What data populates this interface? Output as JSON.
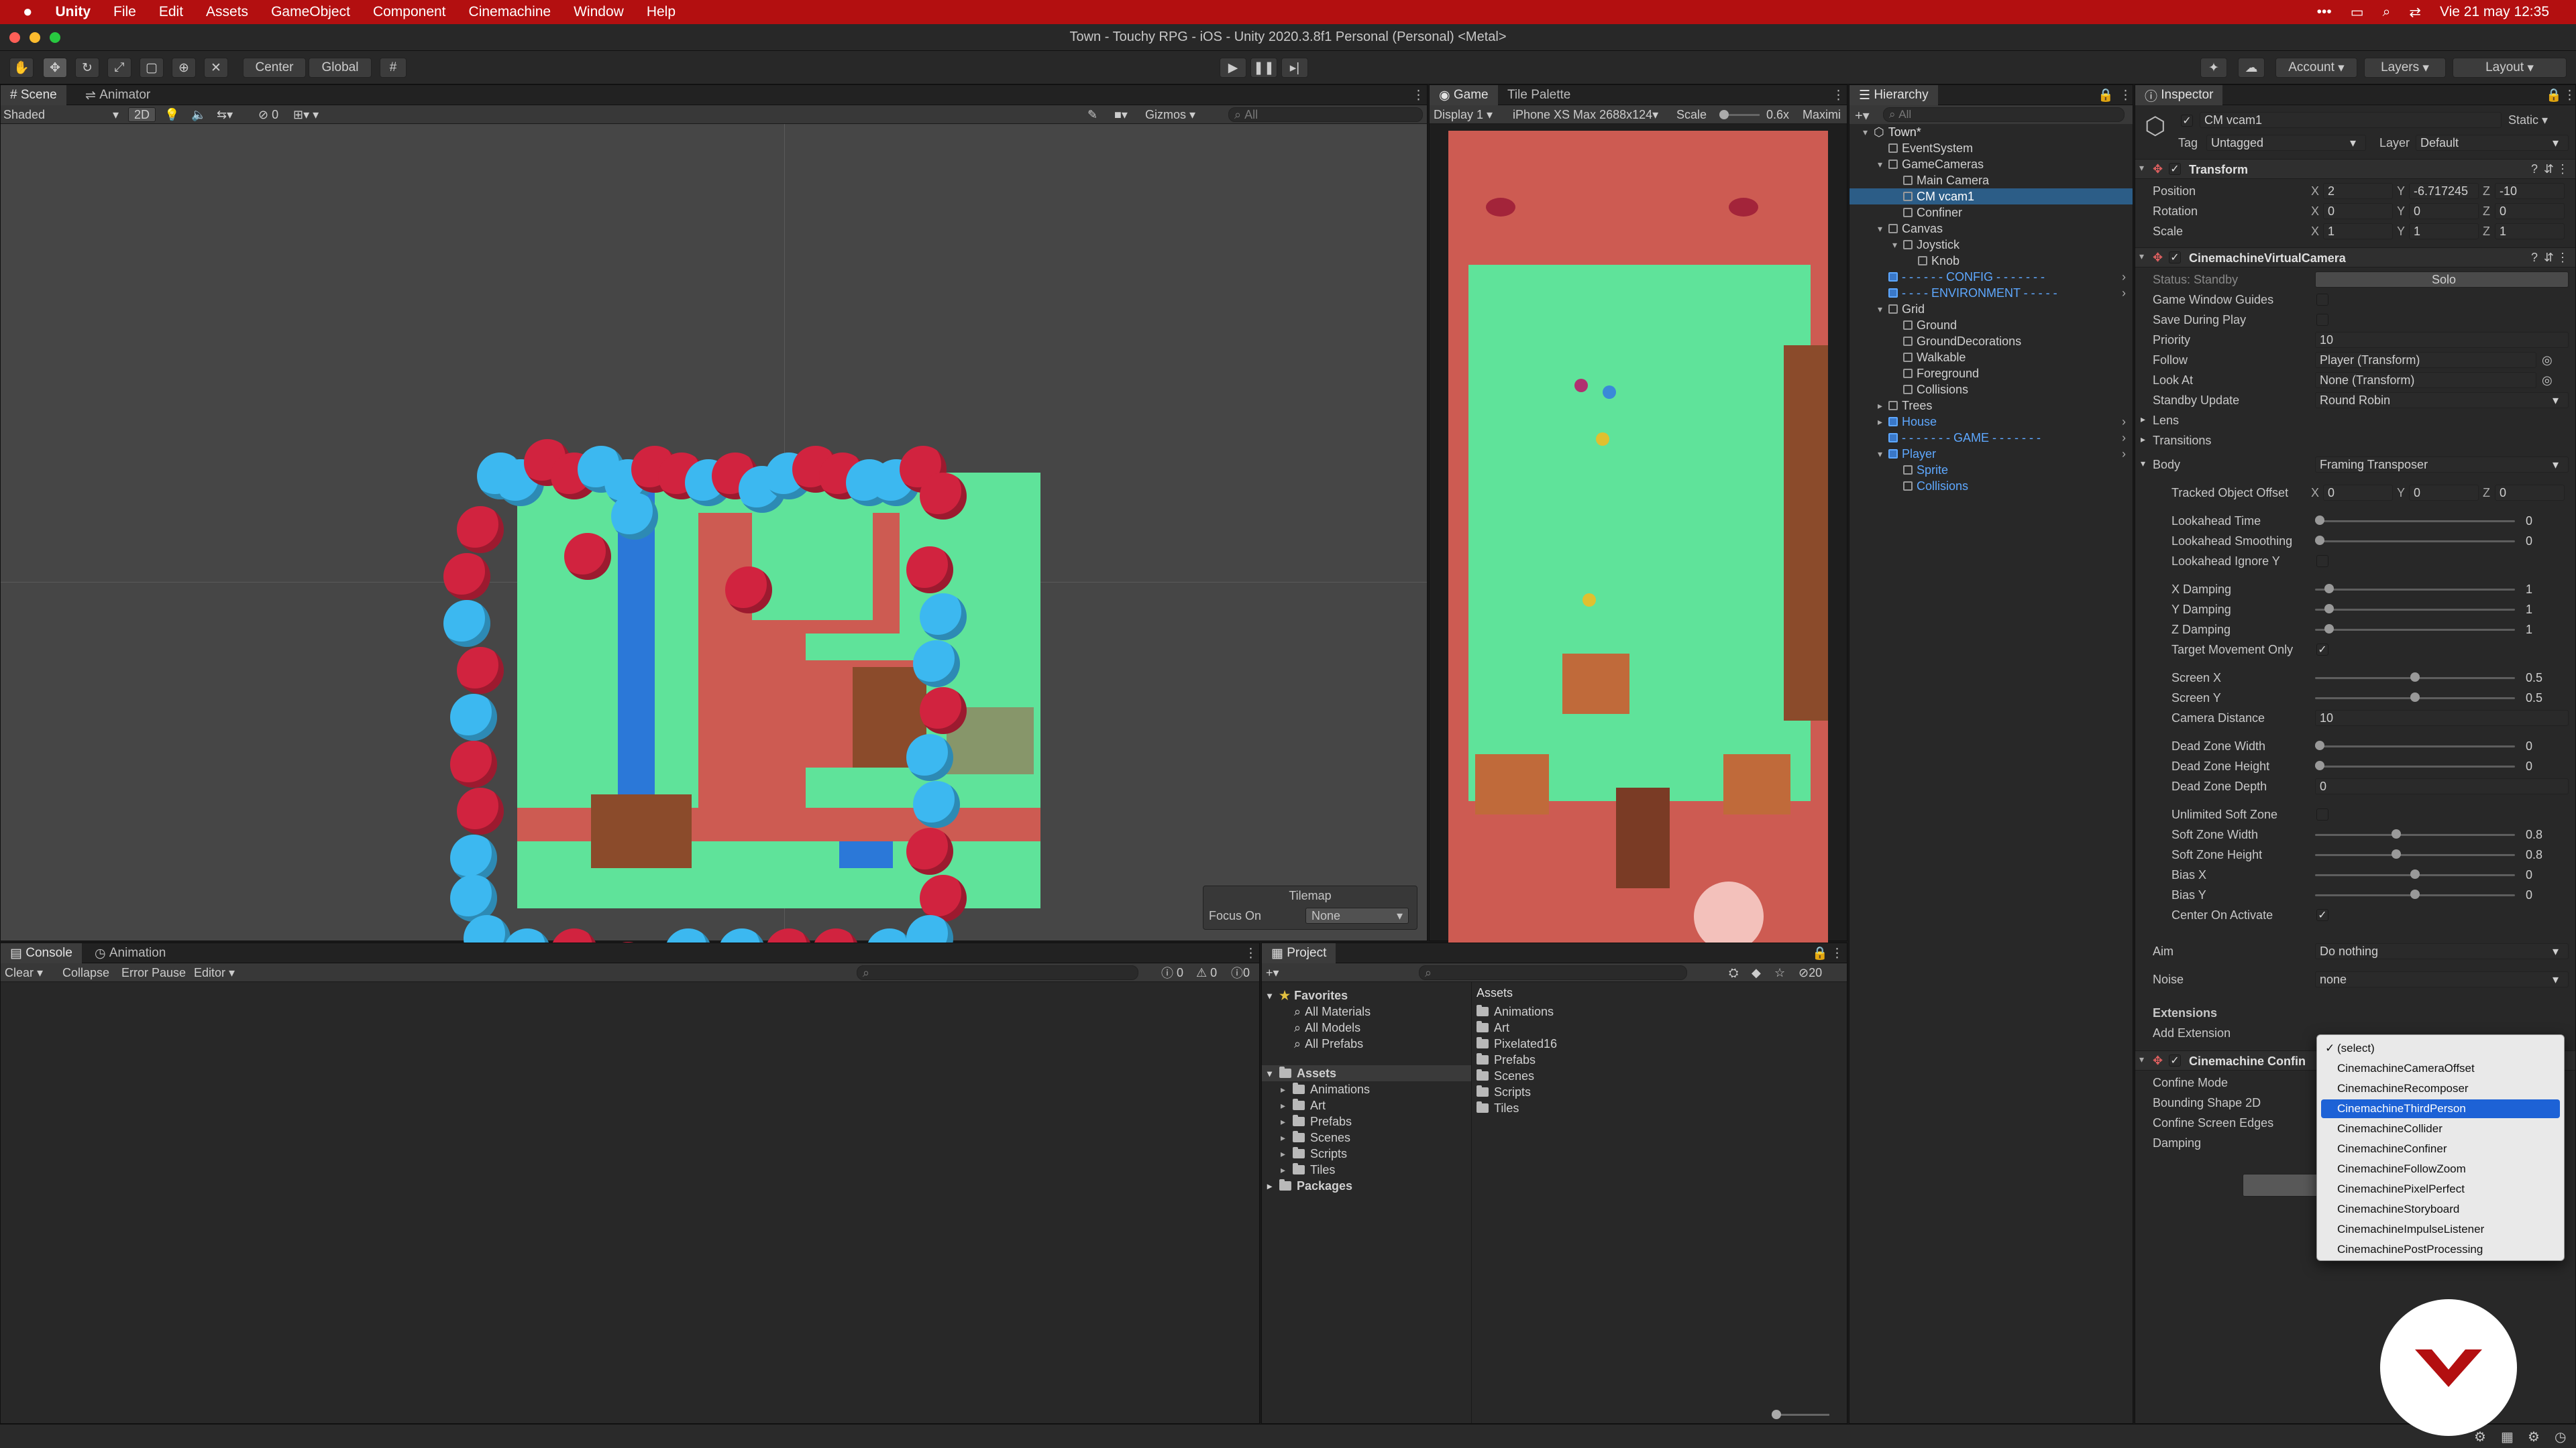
{
  "mac_menu": {
    "app": "Unity",
    "items": [
      "File",
      "Edit",
      "Assets",
      "GameObject",
      "Component",
      "Cinemachine",
      "Window",
      "Help"
    ],
    "clock": "Vie 21 may  12:35"
  },
  "window": {
    "title": "Town - Touchy RPG - iOS - Unity 2020.3.8f1 Personal (Personal) <Metal>"
  },
  "toolbar": {
    "pivot": "Center",
    "space": "Global",
    "account": "Account",
    "layers": "Layers",
    "layout": "Layout"
  },
  "scene": {
    "tabs": [
      "Scene",
      "Animator"
    ],
    "shading": "Shaded",
    "mode2d": "2D",
    "gizmos": "Gizmos",
    "search_placeholder": "All",
    "hidden_count": "0",
    "tilemap_overlay": {
      "title": "Tilemap",
      "focus_label": "Focus On",
      "focus_value": "None"
    }
  },
  "game": {
    "tabs": [
      "Game",
      "Tile Palette"
    ],
    "display": "Display 1",
    "resolution": "iPhone XS Max 2688x124",
    "scale_label": "Scale",
    "scale_value": "0.6x",
    "maximize": "Maximi"
  },
  "hierarchy": {
    "tab": "Hierarchy",
    "search_placeholder": "All",
    "items": [
      {
        "label": "Town*",
        "depth": 0,
        "arrow": "▾",
        "color": "#e0e0e0",
        "icon": "unity-scene-icon"
      },
      {
        "label": "EventSystem",
        "depth": 1,
        "arrow": "",
        "color": "#d0d0d0"
      },
      {
        "label": "GameCameras",
        "depth": 1,
        "arrow": "▾",
        "color": "#d0d0d0"
      },
      {
        "label": "Main Camera",
        "depth": 2,
        "arrow": "",
        "color": "#d0d0d0"
      },
      {
        "label": "CM vcam1",
        "depth": 2,
        "arrow": "",
        "color": "#ffffff",
        "selected": true
      },
      {
        "label": "Confiner",
        "depth": 2,
        "arrow": "",
        "color": "#d0d0d0"
      },
      {
        "label": "Canvas",
        "depth": 1,
        "arrow": "▾",
        "color": "#d0d0d0"
      },
      {
        "label": "Joystick",
        "depth": 2,
        "arrow": "▾",
        "color": "#d0d0d0"
      },
      {
        "label": "Knob",
        "depth": 3,
        "arrow": "",
        "color": "#d0d0d0"
      },
      {
        "label": "- - - - - - CONFIG - - - - - - -",
        "depth": 1,
        "arrow": "",
        "color": "#5ea8ff",
        "prefab": true
      },
      {
        "label": "- - - - ENVIRONMENT - - - - -",
        "depth": 1,
        "arrow": "",
        "color": "#5ea8ff",
        "prefab": true
      },
      {
        "label": "Grid",
        "depth": 1,
        "arrow": "▾",
        "color": "#d0d0d0"
      },
      {
        "label": "Ground",
        "depth": 2,
        "arrow": "",
        "color": "#d0d0d0"
      },
      {
        "label": "GroundDecorations",
        "depth": 2,
        "arrow": "",
        "color": "#d0d0d0"
      },
      {
        "label": "Walkable",
        "depth": 2,
        "arrow": "",
        "color": "#d0d0d0"
      },
      {
        "label": "Foreground",
        "depth": 2,
        "arrow": "",
        "color": "#d0d0d0"
      },
      {
        "label": "Collisions",
        "depth": 2,
        "arrow": "",
        "color": "#d0d0d0"
      },
      {
        "label": "Trees",
        "depth": 1,
        "arrow": "▸",
        "color": "#d0d0d0"
      },
      {
        "label": "House",
        "depth": 1,
        "arrow": "▸",
        "color": "#5ea8ff",
        "prefab": true
      },
      {
        "label": "- - - - - - - GAME - - - - - - -",
        "depth": 1,
        "arrow": "",
        "color": "#5ea8ff",
        "prefab": true
      },
      {
        "label": "Player",
        "depth": 1,
        "arrow": "▾",
        "color": "#5ea8ff",
        "prefab": true
      },
      {
        "label": "Sprite",
        "depth": 2,
        "arrow": "",
        "color": "#5ea8ff"
      },
      {
        "label": "Collisions",
        "depth": 2,
        "arrow": "",
        "color": "#5ea8ff"
      }
    ]
  },
  "inspector": {
    "tab": "Inspector",
    "object_name": "CM vcam1",
    "static_label": "Static",
    "tag_label": "Tag",
    "tag_value": "Untagged",
    "layer_label": "Layer",
    "layer_value": "Default",
    "transform": {
      "title": "Transform",
      "rows": [
        {
          "label": "Position",
          "x": "2",
          "y": "-6.717245",
          "z": "-10"
        },
        {
          "label": "Rotation",
          "x": "0",
          "y": "0",
          "z": "0"
        },
        {
          "label": "Scale",
          "x": "1",
          "y": "1",
          "z": "1"
        }
      ]
    },
    "vcam": {
      "title": "CinemachineVirtualCamera",
      "status_label": "Status: Standby",
      "solo": "Solo",
      "game_window_guides": "Game Window Guides",
      "save_during_play": "Save During Play",
      "priority_label": "Priority",
      "priority": "10",
      "follow_label": "Follow",
      "follow": "Player (Transform)",
      "lookat_label": "Look At",
      "lookat": "None (Transform)",
      "standby_label": "Standby Update",
      "standby": "Round Robin",
      "lens": "Lens",
      "transitions": "Transitions",
      "body_label": "Body",
      "body": "Framing Transposer",
      "tracked_offset_label": "Tracked Object Offset",
      "tracked_offset": {
        "x": "0",
        "y": "0",
        "z": "0"
      },
      "sliders": [
        {
          "label": "Lookahead Time",
          "value": "0",
          "fraction": 0
        },
        {
          "label": "Lookahead Smoothing",
          "value": "0",
          "fraction": 0
        }
      ],
      "lookahead_ignore_y": "Lookahead Ignore Y",
      "damping": [
        {
          "label": "X Damping",
          "value": "1",
          "fraction": 0.05
        },
        {
          "label": "Y Damping",
          "value": "1",
          "fraction": 0.05
        },
        {
          "label": "Z Damping",
          "value": "1",
          "fraction": 0.05
        }
      ],
      "target_movement_only": "Target Movement Only",
      "screen": [
        {
          "label": "Screen X",
          "value": "0.5",
          "fraction": 0.5
        },
        {
          "label": "Screen Y",
          "value": "0.5",
          "fraction": 0.5
        }
      ],
      "camera_distance_label": "Camera Distance",
      "camera_distance": "10",
      "dead_zone": [
        {
          "label": "Dead Zone Width",
          "value": "0",
          "fraction": 0
        },
        {
          "label": "Dead Zone Height",
          "value": "0",
          "fraction": 0
        }
      ],
      "dead_zone_depth_label": "Dead Zone Depth",
      "dead_zone_depth": "0",
      "unlimited_soft_zone": "Unlimited Soft Zone",
      "soft_zone": [
        {
          "label": "Soft Zone Width",
          "value": "0.8",
          "fraction": 0.4
        },
        {
          "label": "Soft Zone Height",
          "value": "0.8",
          "fraction": 0.4
        },
        {
          "label": "Bias X",
          "value": "0",
          "fraction": 0.5
        },
        {
          "label": "Bias Y",
          "value": "0",
          "fraction": 0.5
        }
      ],
      "center_on_activate": "Center On Activate",
      "aim_label": "Aim",
      "aim": "Do nothing",
      "noise_label": "Noise",
      "noise": "none",
      "extensions": "Extensions",
      "add_extension": "Add Extension"
    },
    "confiner": {
      "title": "Cinemachine Confin",
      "rows": [
        "Confine Mode",
        "Bounding Shape 2D",
        "Confine Screen Edges",
        "Damping"
      ]
    },
    "extension_menu": {
      "items": [
        "(select)",
        "CinemachineCameraOffset",
        "CinemachineRecomposer",
        "CinemachineThirdPerson",
        "CinemachineCollider",
        "CinemachineConfiner",
        "CinemachineFollowZoom",
        "CinemachinePixelPerfect",
        "CinemachineStoryboard",
        "CinemachineImpulseListener",
        "CinemachinePostProcessing"
      ],
      "checked_index": 0,
      "highlighted_index": 3
    }
  },
  "console": {
    "tabs": [
      "Console",
      "Animation"
    ],
    "buttons": [
      "Clear",
      "Collapse",
      "Error Pause",
      "Editor"
    ],
    "counts": [
      "0",
      "0",
      "0"
    ]
  },
  "project": {
    "tab": "Project",
    "hidden_count": "20",
    "favorites_label": "Favorites",
    "favorites": [
      "All Materials",
      "All Models",
      "All Prefabs"
    ],
    "tree_root": "Assets",
    "tree": [
      "Animations",
      "Art",
      "Prefabs",
      "Scenes",
      "Scripts",
      "Tiles"
    ],
    "packages": "Packages",
    "breadcrumb": "Assets",
    "grid_items": [
      "Animations",
      "Art",
      "Pixelated16",
      "Prefabs",
      "Scenes",
      "Scripts",
      "Tiles"
    ]
  },
  "colors": {
    "mac_bar": "#b30f10",
    "selection": "#2c5d87",
    "prefab_blue": "#5ea8ff",
    "menu_highlight": "#1d62d6",
    "grass": "#5fe39a",
    "path": "#cd5b52",
    "water": "#2b78d8"
  }
}
